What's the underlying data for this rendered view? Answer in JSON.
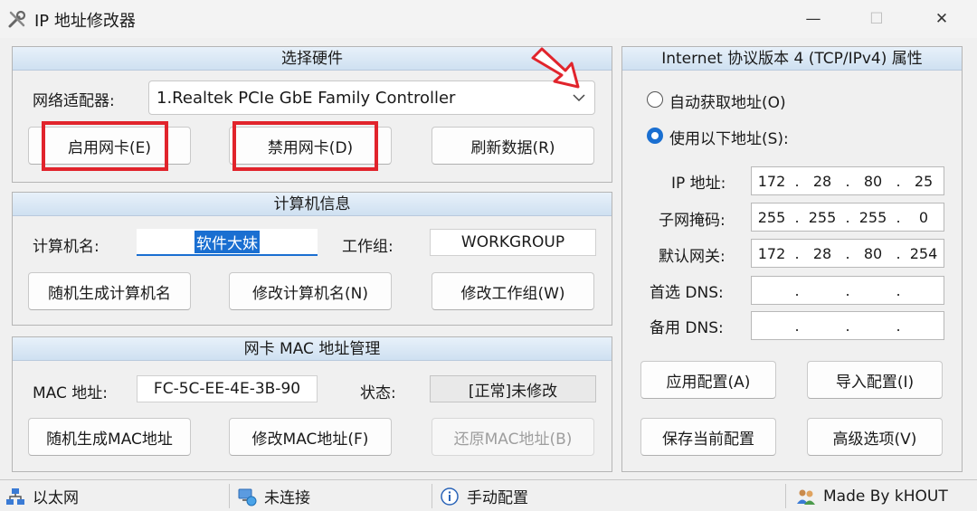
{
  "window": {
    "title": "IP 地址修改器",
    "min_symbol": "—",
    "max_symbol": "☐",
    "close_symbol": "✕"
  },
  "hardware": {
    "header": "选择硬件",
    "adapter_label": "网络适配器:",
    "adapter_value": "1.Realtek PCIe GbE Family Controller",
    "enable_btn": "启用网卡(E)",
    "disable_btn": "禁用网卡(D)",
    "refresh_btn": "刷新数据(R)"
  },
  "computer": {
    "header": "计算机信息",
    "name_label": "计算机名:",
    "name_value": "软件大妹",
    "workgroup_label": "工作组:",
    "workgroup_value": "WORKGROUP",
    "random_name_btn": "随机生成计算机名",
    "modify_name_btn": "修改计算机名(N)",
    "modify_workgroup_btn": "修改工作组(W)"
  },
  "mac": {
    "header": "网卡 MAC 地址管理",
    "mac_label": "MAC 地址:",
    "mac_value": "FC-5C-EE-4E-3B-90",
    "status_label": "状态:",
    "status_value": "[正常]未修改",
    "random_mac_btn": "随机生成MAC地址",
    "modify_mac_btn": "修改MAC地址(F)",
    "restore_mac_btn": "还原MAC地址(B)"
  },
  "ipv4": {
    "header": "Internet 协议版本 4 (TCP/IPv4) 属性",
    "auto_radio": "自动获取地址(O)",
    "manual_radio": "使用以下地址(S):",
    "ip_label": "IP 地址:",
    "ip": [
      "172",
      "28",
      "80",
      "25"
    ],
    "mask_label": "子网掩码:",
    "mask": [
      "255",
      "255",
      "255",
      "0"
    ],
    "gateway_label": "默认网关:",
    "gateway": [
      "172",
      "28",
      "80",
      "254"
    ],
    "dns1_label": "首选 DNS:",
    "dns1": [
      "",
      "",
      "",
      ""
    ],
    "dns2_label": "备用 DNS:",
    "dns2": [
      "",
      "",
      "",
      ""
    ],
    "apply_btn": "应用配置(A)",
    "import_btn": "导入配置(I)",
    "save_btn": "保存当前配置",
    "advanced_btn": "高级选项(V)"
  },
  "status": {
    "adapter": "以太网",
    "connection": "未连接",
    "mode": "手动配置",
    "author": "Made By kHOUT"
  },
  "colors": {
    "highlight_red": "#e1242c",
    "selection_blue": "#1a6fd1"
  }
}
